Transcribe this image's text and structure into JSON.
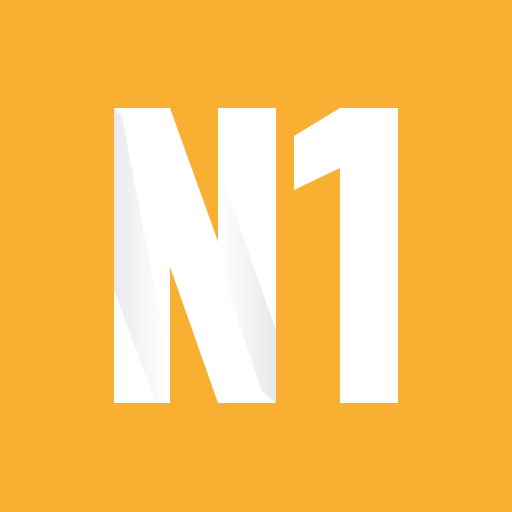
{
  "logo": {
    "text": "N1",
    "icon": "n1-logo-icon",
    "colors": {
      "background": "#F9B032",
      "letter": "#FFFFFF",
      "shade_light": "#F4F4F6",
      "shade_dark": "#D8D9DD"
    }
  }
}
